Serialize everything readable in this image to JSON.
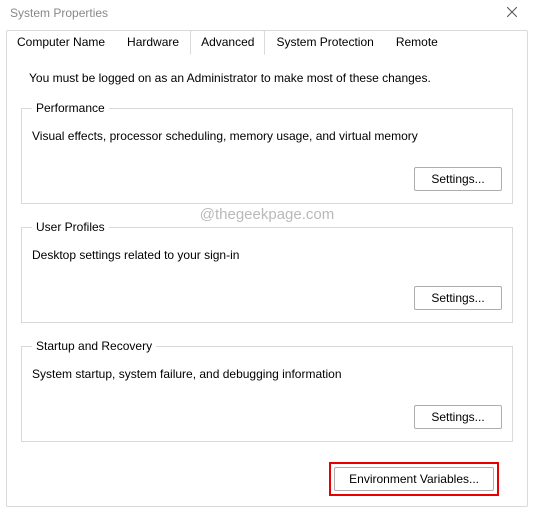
{
  "window": {
    "title": "System Properties"
  },
  "tabs": {
    "computer_name": "Computer Name",
    "hardware": "Hardware",
    "advanced": "Advanced",
    "system_protection": "System Protection",
    "remote": "Remote"
  },
  "advanced_tab": {
    "intro": "You must be logged on as an Administrator to make most of these changes.",
    "performance": {
      "title": "Performance",
      "desc": "Visual effects, processor scheduling, memory usage, and virtual memory",
      "button": "Settings..."
    },
    "user_profiles": {
      "title": "User Profiles",
      "desc": "Desktop settings related to your sign-in",
      "button": "Settings..."
    },
    "startup_recovery": {
      "title": "Startup and Recovery",
      "desc": "System startup, system failure, and debugging information",
      "button": "Settings..."
    },
    "env_vars_button": "Environment Variables..."
  },
  "watermark": "@thegeekpage.com"
}
